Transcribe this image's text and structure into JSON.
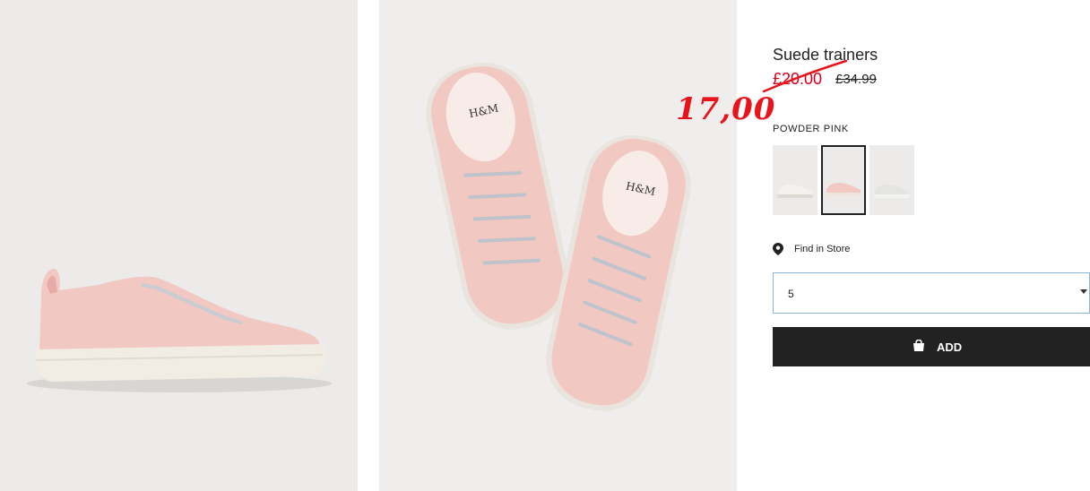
{
  "product": {
    "title": "Suede trainers",
    "sale_price": "£20.00",
    "original_price": "£34.99",
    "handwritten_price": "17,00",
    "color_name": "POWDER PINK",
    "swatches": [
      {
        "name": "white",
        "selected": false
      },
      {
        "name": "powder-pink",
        "selected": true
      },
      {
        "name": "light-grey",
        "selected": false
      }
    ],
    "find_in_store": "Find in Store",
    "size": {
      "selected": "5"
    },
    "add_button": "ADD"
  },
  "colors": {
    "sale_red": "#d6001c",
    "annotation_red": "#e8141c",
    "button_black": "#222222",
    "select_border": "#8cb4d8",
    "shoe_pink": "#f2c8c3"
  },
  "icons": {
    "location": "map-pin-icon",
    "bag": "shopping-bag-icon",
    "caret": "chevron-down-icon"
  }
}
